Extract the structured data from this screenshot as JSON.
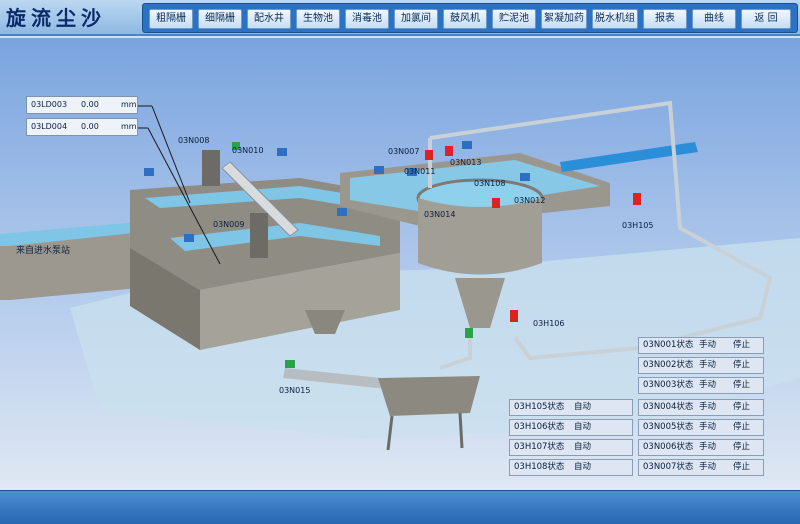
{
  "header": {
    "title": "旋流尘沙",
    "nav": [
      "粗隔栅",
      "细隔栅",
      "配水井",
      "生物池",
      "消毒池",
      "加氯间",
      "鼓风机",
      "贮泥池",
      "絮凝加药",
      "脱水机组",
      "报表",
      "曲线",
      "返 回"
    ]
  },
  "scene": {
    "inlet_label": "来自进水泵站",
    "levels": [
      {
        "tag": "03LD003",
        "value": "0.00",
        "unit": "mm"
      },
      {
        "tag": "03LD004",
        "value": "0.00",
        "unit": "mm"
      }
    ],
    "equipment_labels": {
      "w008": "03N008",
      "w010": "03N010",
      "w009": "03N009",
      "w007": "03N007",
      "w013": "03N013",
      "w011": "03N011",
      "w108": "03N108",
      "w012": "03N012",
      "w014": "03N014",
      "h105": "03H105",
      "h106": "03H106",
      "w015": "03N015"
    }
  },
  "status_left": [
    {
      "name": "03H105状态",
      "mode": "自动"
    },
    {
      "name": "03H106状态",
      "mode": "自动"
    },
    {
      "name": "03H107状态",
      "mode": "自动"
    },
    {
      "name": "03H108状态",
      "mode": "自动"
    }
  ],
  "status_right": [
    {
      "name": "03N001状态",
      "mode": "手动",
      "state": "停止"
    },
    {
      "name": "03N002状态",
      "mode": "手动",
      "state": "停止"
    },
    {
      "name": "03N003状态",
      "mode": "手动",
      "state": "停止"
    },
    {
      "name": "03N004状态",
      "mode": "手动",
      "state": "停止"
    },
    {
      "name": "03N005状态",
      "mode": "手动",
      "state": "停止"
    },
    {
      "name": "03N006状态",
      "mode": "手动",
      "state": "停止"
    },
    {
      "name": "03N007状态",
      "mode": "手动",
      "state": "停止"
    }
  ],
  "colors": {
    "header_bg": "#9cc4ec",
    "nav_bar": "#2b72c4",
    "water": "#79c3e6",
    "concrete": "#9d9a91",
    "pipe": "#c9d1d8",
    "blue_pipe": "#2a8fd8",
    "valve_red": "#d9251f",
    "valve_green": "#2aa24a"
  }
}
